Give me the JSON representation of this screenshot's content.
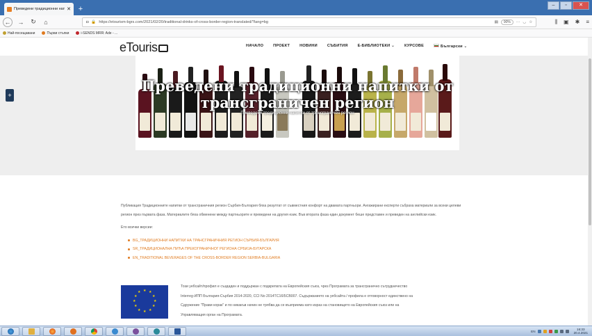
{
  "browser": {
    "tab_title": "Преведени традиционни нап",
    "url": "https://etourism-bgrs.com/2021/02/20/traditional-drinks-of-cross-border-region-translated/?lang=bg",
    "zoom": "90%",
    "bookmarks": [
      {
        "label": "Най-посещавани",
        "color": "#c0a030"
      },
      {
        "label": "Първи стъпки",
        "color": "#e07b20"
      },
      {
        "label": "i-SENDS MRR: Ade - ...",
        "color": "#c0272d"
      }
    ]
  },
  "site": {
    "logo": "eTouris",
    "menu": [
      "НАЧАЛО",
      "ПРОЕКТ",
      "НОВИНИ",
      "СЪБИТИЯ",
      "Е-БИБЛИОТЕКИ ⌄",
      "КУРСОВЕ",
      "Български ⌄"
    ],
    "hero_title": "Преведени традиционни напитки от трансграничен регион",
    "hero_subtitle": "Преведени традиционни напитки от трансграничен регион",
    "paragraph": "Публикация Традиционните напитки от трансграничния регион Сърбия-България бяха резултат от съвместния конфорт на двамата партньори. Ангажирани експерти събраха материали за всеки целеви регион през първата фаза. Материалите бяха обменени между партньорите и преведени на другия език. Във втората фаза един документ беше представен и преведен на английски език.",
    "versions_label": "Ето всички версии:",
    "links": [
      "BG_ТРАДИЦИОННИ НАПИТКИ НА ТРАНСГРАНИЧНИЯ РЕГИОН СЪРБИЯ-БЪЛГАРИЯ",
      "SR_ТРАДИЦИОНАЛНА ПИЋА ПРЕКОГРАНИЧНОГ РЕГИОНА СРБИЈА-БУГАРСКА",
      "EN_TRADITIONAL BEVERAGES OF THE CROSS-BORDER REGION SERBIA-BULGARIA"
    ],
    "eu_text": [
      "Този уебсайт/профил е създаден и поддържан с подкрепата на Европейския съюз, чрез Програмата за трансгранично сътрудничество",
      "Interreg-ИПП България-Сърбия 2014-2020, CCI No 2014TC16I5CB007. Съдържанието на уебсайта / профила е отговорност единствено на",
      "Сдружение \"Прави корак\" и по никакъв начин не трябва да се възприема като израз на становището на Европейския съюз или на",
      "Управляващия орган на Програмата."
    ]
  },
  "taskbar": {
    "time": "16:33",
    "date": "20.4.2021"
  }
}
